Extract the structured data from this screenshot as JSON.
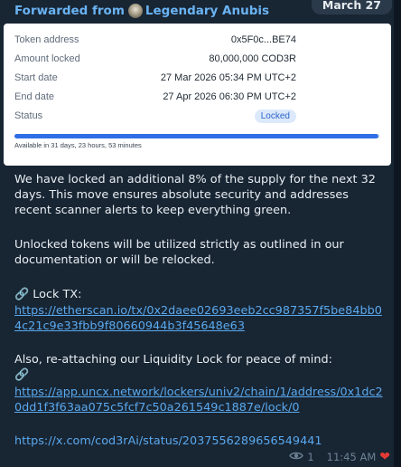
{
  "date_pill": "March 27",
  "forward": {
    "prefix": "Forwarded from",
    "name": "Legendary Anubis"
  },
  "card": {
    "rows": [
      {
        "label": "Token address",
        "value": "0x5F0c...BE74"
      },
      {
        "label": "Amount locked",
        "value": "80,000,000 COD3R"
      },
      {
        "label": "Start date",
        "value": "27 Mar 2026 05:34 PM UTC+2"
      },
      {
        "label": "End date",
        "value": "27 Apr 2026 06:30 PM UTC+2"
      }
    ],
    "status_label": "Status",
    "status_value": "Locked",
    "progress_fraction": 0.995,
    "available_text": "Available in 31 days, 23 hours, 53 minutes"
  },
  "message": {
    "p1": "We have locked an additional 8% of the supply for the next 32 days. This move ensures absolute security and addresses recent scanner alerts to keep everything green.",
    "p2": "Unlocked tokens will be utilized strictly as outlined in our documentation or will be relocked.",
    "lock_tx_label": "Lock TX:",
    "lock_tx_url": "https://etherscan.io/tx/0x2daee02693eeb2cc987357f5be84bb04c21c9e33fbb9f80660944b3f45648e63",
    "liquidity_text": "Also, re-attaching our Liquidity Lock for peace of mind:",
    "liquidity_url": "https://app.uncx.network/lockers/univ2/chain/1/address/0x1dc20dd1f3f63aa075c5fcf7c50a261549c1887e/lock/0",
    "x_url": "https://x.com/cod3rAi/status/2037556289656549441"
  },
  "meta": {
    "views": "1",
    "time": "11:45 AM"
  },
  "icons": {
    "link": "link-icon",
    "views": "eye-icon",
    "reaction": "heart-icon"
  }
}
